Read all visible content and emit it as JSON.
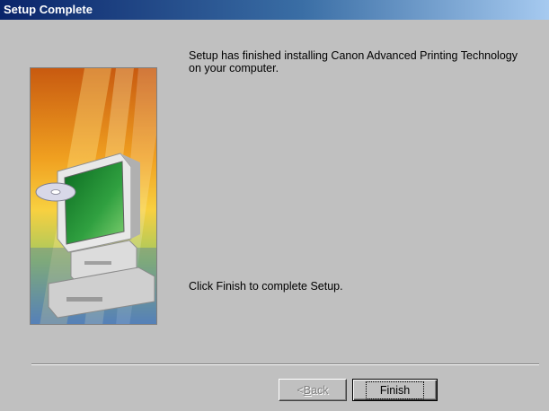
{
  "window": {
    "title": "Setup Complete"
  },
  "content": {
    "message": "Setup has finished installing Canon Advanced Printing Technology on your computer.",
    "instruction": "Click Finish to complete Setup."
  },
  "buttons": {
    "back_prefix": "< ",
    "back_mnemonic": "B",
    "back_rest": "ack",
    "finish_label": "Finish"
  },
  "colors": {
    "title_bar_start": "#0a246a",
    "title_bar_end": "#a6caf0",
    "dialog_face": "#c0c0c0"
  }
}
